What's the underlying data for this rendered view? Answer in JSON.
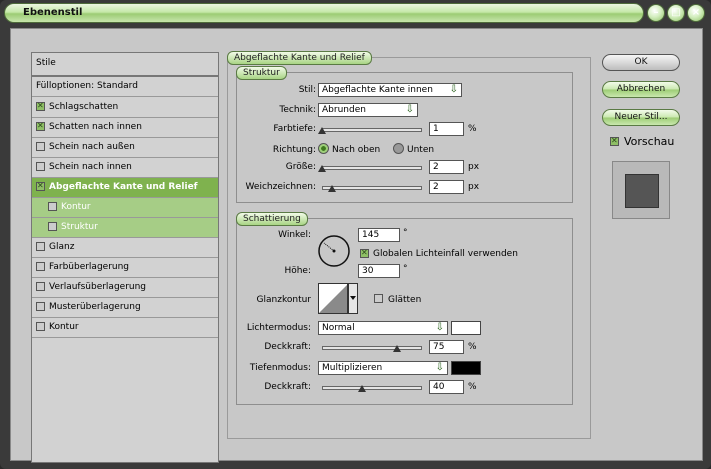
{
  "window": {
    "title": "Ebenenstil"
  },
  "sidebar": {
    "header": "Stile",
    "blend_options": "Fülloptionen: Standard",
    "items": [
      {
        "label": "Schlagschatten",
        "checked": true
      },
      {
        "label": "Schatten nach innen",
        "checked": true
      },
      {
        "label": "Schein nach außen",
        "checked": false
      },
      {
        "label": "Schein nach innen",
        "checked": false
      },
      {
        "label": "Abgeflachte Kante und Relief",
        "checked": true,
        "selected": true
      },
      {
        "label": "Kontur",
        "checked": false,
        "sub": true
      },
      {
        "label": "Struktur",
        "checked": false,
        "sub": true
      },
      {
        "label": "Glanz",
        "checked": false
      },
      {
        "label": "Farbüberlagerung",
        "checked": false
      },
      {
        "label": "Verlaufsüberlagerung",
        "checked": false
      },
      {
        "label": "Musterüberlagerung",
        "checked": false
      },
      {
        "label": "Kontur",
        "checked": false
      }
    ]
  },
  "panel": {
    "title": "Abgeflachte Kante und Relief",
    "structure": {
      "title": "Struktur",
      "style_label": "Stil:",
      "style_value": "Abgeflachte Kante innen",
      "technique_label": "Technik:",
      "technique_value": "Abrunden",
      "depth_label": "Farbtiefe:",
      "depth_value": "1",
      "depth_unit": "%",
      "direction_label": "Richtung:",
      "direction_up": "Nach oben",
      "direction_down": "Unten",
      "size_label": "Größe:",
      "size_value": "2",
      "size_unit": "px",
      "soften_label": "Weichzeichnen:",
      "soften_value": "2",
      "soften_unit": "px"
    },
    "shading": {
      "title": "Schattierung",
      "angle_label": "Winkel:",
      "angle_value": "145",
      "angle_unit": "°",
      "global_light": "Globalen Lichteinfall verwenden",
      "altitude_label": "Höhe:",
      "altitude_value": "30",
      "altitude_unit": "°",
      "gloss_label": "Glanzkontur",
      "antialias": "Glätten",
      "highlight_label": "Lichtermodus:",
      "highlight_value": "Normal",
      "highlight_color": "#ffffff",
      "highlight_opacity_label": "Deckkraft:",
      "highlight_opacity": "75",
      "highlight_opacity_unit": "%",
      "shadow_label": "Tiefenmodus:",
      "shadow_value": "Multiplizieren",
      "shadow_color": "#000000",
      "shadow_opacity_label": "Deckkraft:",
      "shadow_opacity": "40",
      "shadow_opacity_unit": "%"
    }
  },
  "buttons": {
    "ok": "OK",
    "cancel": "Abbrechen",
    "new_style": "Neuer Stil...",
    "preview": "Vorschau"
  }
}
